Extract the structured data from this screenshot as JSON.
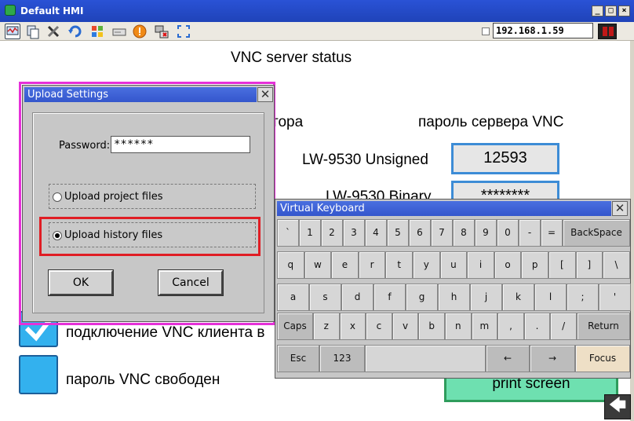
{
  "window": {
    "title": "Default HMI",
    "buttons": [
      "_",
      "□",
      "×"
    ]
  },
  "toolbar": {
    "icons": [
      "monitor-icon",
      "copy-icon",
      "tools-icon",
      "refresh-icon",
      "windows-icon",
      "drive-icon",
      "warning-icon",
      "network-icon",
      "fullscreen-icon"
    ],
    "ip_address": "192.168.1.59"
  },
  "main": {
    "heading": "VNC server status",
    "label_partial": "тора",
    "vnc_password_label": "пароль сервера VNC",
    "unsigned_label": "LW-9530 Unsigned",
    "unsigned_value": "12593",
    "binary_label_partial": "LW-9530 Binary",
    "binary_value": "********",
    "vnc_client_label": "подключение VNC клиента в",
    "vnc_free_label": "пароль VNC свободен",
    "print_button": "print screen"
  },
  "upload_dialog": {
    "title": "Upload Settings",
    "password_label": "Password:",
    "password_value": "******",
    "option_project": "Upload project files",
    "option_history": "Upload history files",
    "selected": "history",
    "ok": "OK",
    "cancel": "Cancel"
  },
  "keyboard": {
    "title": "Virtual Keyboard",
    "row1": [
      "`",
      "1",
      "2",
      "3",
      "4",
      "5",
      "6",
      "7",
      "8",
      "9",
      "0",
      "-",
      "="
    ],
    "backspace": "BackSpace",
    "row2": [
      "q",
      "w",
      "e",
      "r",
      "t",
      "y",
      "u",
      "i",
      "o",
      "p",
      "[",
      "]",
      "\\"
    ],
    "row3": [
      "a",
      "s",
      "d",
      "f",
      "g",
      "h",
      "j",
      "k",
      "l",
      ";",
      "'"
    ],
    "caps": "Caps",
    "row4": [
      "z",
      "x",
      "c",
      "v",
      "b",
      "n",
      "m",
      ",",
      ".",
      "/"
    ],
    "return": "Return",
    "esc": "Esc",
    "num": "123",
    "left": "←",
    "right": "→",
    "focus": "Focus"
  }
}
